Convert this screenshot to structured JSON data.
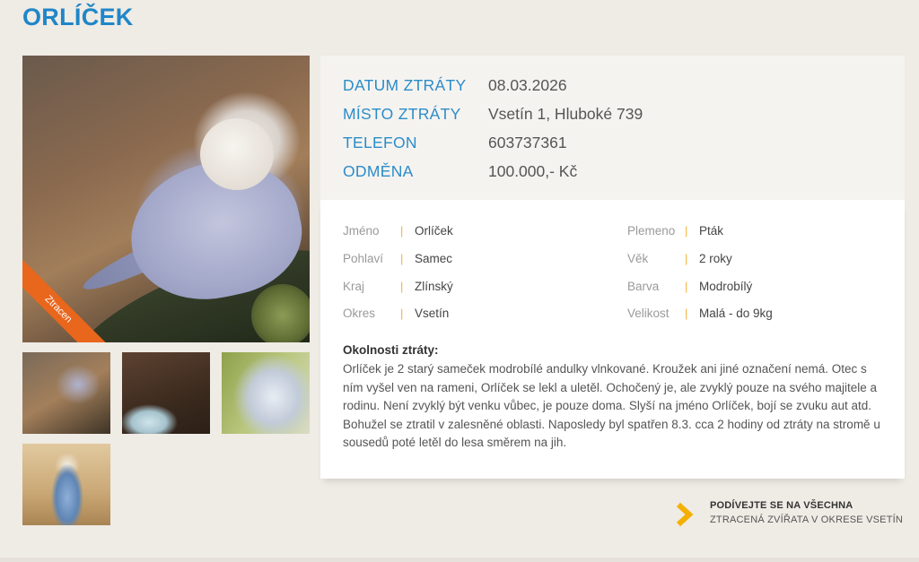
{
  "title": "ORLÍČEK",
  "main_image": {
    "ribbon": "Ztracen"
  },
  "details": [
    {
      "label": "DATUM ZTRÁTY",
      "value": "08.03.2026"
    },
    {
      "label": "MÍSTO ZTRÁTY",
      "value": "Vsetín 1, Hluboké 739"
    },
    {
      "label": "TELEFON",
      "value": "603737361"
    },
    {
      "label": "ODMĚNA",
      "value": "100.000,- Kč"
    }
  ],
  "attributes_left": [
    {
      "key": "Jméno",
      "value": "Orlíček"
    },
    {
      "key": "Pohlaví",
      "value": "Samec"
    },
    {
      "key": "Kraj",
      "value": "Zlínský"
    },
    {
      "key": "Okres",
      "value": "Vsetín"
    }
  ],
  "attributes_right": [
    {
      "key": "Plemeno",
      "value": "Pták"
    },
    {
      "key": "Věk",
      "value": "2 roky"
    },
    {
      "key": "Barva",
      "value": "Modrobílý"
    },
    {
      "key": "Velikost",
      "value": "Malá - do 9kg"
    }
  ],
  "circumstances": {
    "title": "Okolnosti ztráty:",
    "text": "Orlíček je 2 starý sameček modrobílé andulky vlnkované. Kroužek ani jiné označení nemá. Otec s ním vyšel ven na rameni, Orlíček se lekl a uletěl. Ochočený je, ale zvyklý pouze na svého majitele a rodinu. Není zvyklý být venku vůbec, je pouze doma. Slyší na jméno Orlíček, bojí se zvuku aut atd. Bohužel se ztratil v zalesněné oblasti. Naposledy byl spatřen 8.3. cca 2 hodiny od ztráty na stromě u sousedů poté letěl do lesa směrem na jih."
  },
  "more_link": {
    "line1": "PODÍVEJTE SE NA VŠECHNA",
    "line2": "ZTRACENÁ ZVÍŘATA V OKRESE VSETÍN"
  },
  "colors": {
    "accent_blue": "#2b8cc8",
    "ribbon_orange": "#e9661d",
    "chevron_yellow": "#f4b000"
  }
}
